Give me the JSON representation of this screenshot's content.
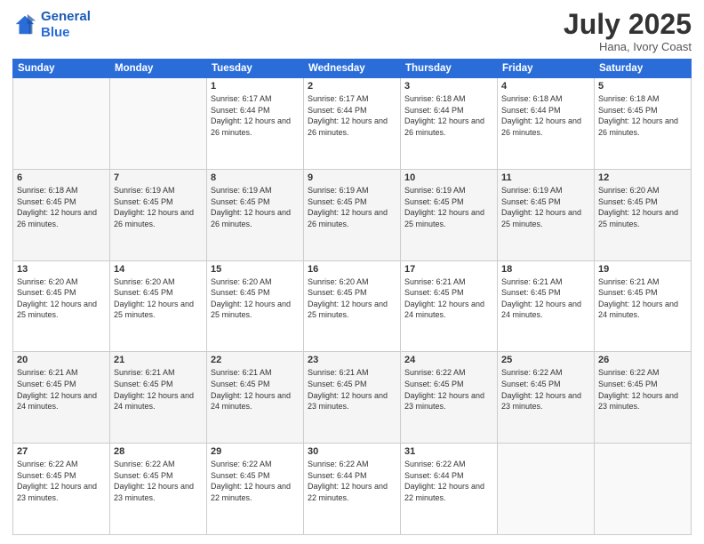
{
  "logo": {
    "line1": "General",
    "line2": "Blue"
  },
  "header": {
    "month": "July 2025",
    "location": "Hana, Ivory Coast"
  },
  "weekdays": [
    "Sunday",
    "Monday",
    "Tuesday",
    "Wednesday",
    "Thursday",
    "Friday",
    "Saturday"
  ],
  "weeks": [
    [
      {
        "day": "",
        "sunrise": "",
        "sunset": "",
        "daylight": ""
      },
      {
        "day": "",
        "sunrise": "",
        "sunset": "",
        "daylight": ""
      },
      {
        "day": "1",
        "sunrise": "Sunrise: 6:17 AM",
        "sunset": "Sunset: 6:44 PM",
        "daylight": "Daylight: 12 hours and 26 minutes."
      },
      {
        "day": "2",
        "sunrise": "Sunrise: 6:17 AM",
        "sunset": "Sunset: 6:44 PM",
        "daylight": "Daylight: 12 hours and 26 minutes."
      },
      {
        "day": "3",
        "sunrise": "Sunrise: 6:18 AM",
        "sunset": "Sunset: 6:44 PM",
        "daylight": "Daylight: 12 hours and 26 minutes."
      },
      {
        "day": "4",
        "sunrise": "Sunrise: 6:18 AM",
        "sunset": "Sunset: 6:44 PM",
        "daylight": "Daylight: 12 hours and 26 minutes."
      },
      {
        "day": "5",
        "sunrise": "Sunrise: 6:18 AM",
        "sunset": "Sunset: 6:45 PM",
        "daylight": "Daylight: 12 hours and 26 minutes."
      }
    ],
    [
      {
        "day": "6",
        "sunrise": "Sunrise: 6:18 AM",
        "sunset": "Sunset: 6:45 PM",
        "daylight": "Daylight: 12 hours and 26 minutes."
      },
      {
        "day": "7",
        "sunrise": "Sunrise: 6:19 AM",
        "sunset": "Sunset: 6:45 PM",
        "daylight": "Daylight: 12 hours and 26 minutes."
      },
      {
        "day": "8",
        "sunrise": "Sunrise: 6:19 AM",
        "sunset": "Sunset: 6:45 PM",
        "daylight": "Daylight: 12 hours and 26 minutes."
      },
      {
        "day": "9",
        "sunrise": "Sunrise: 6:19 AM",
        "sunset": "Sunset: 6:45 PM",
        "daylight": "Daylight: 12 hours and 26 minutes."
      },
      {
        "day": "10",
        "sunrise": "Sunrise: 6:19 AM",
        "sunset": "Sunset: 6:45 PM",
        "daylight": "Daylight: 12 hours and 25 minutes."
      },
      {
        "day": "11",
        "sunrise": "Sunrise: 6:19 AM",
        "sunset": "Sunset: 6:45 PM",
        "daylight": "Daylight: 12 hours and 25 minutes."
      },
      {
        "day": "12",
        "sunrise": "Sunrise: 6:20 AM",
        "sunset": "Sunset: 6:45 PM",
        "daylight": "Daylight: 12 hours and 25 minutes."
      }
    ],
    [
      {
        "day": "13",
        "sunrise": "Sunrise: 6:20 AM",
        "sunset": "Sunset: 6:45 PM",
        "daylight": "Daylight: 12 hours and 25 minutes."
      },
      {
        "day": "14",
        "sunrise": "Sunrise: 6:20 AM",
        "sunset": "Sunset: 6:45 PM",
        "daylight": "Daylight: 12 hours and 25 minutes."
      },
      {
        "day": "15",
        "sunrise": "Sunrise: 6:20 AM",
        "sunset": "Sunset: 6:45 PM",
        "daylight": "Daylight: 12 hours and 25 minutes."
      },
      {
        "day": "16",
        "sunrise": "Sunrise: 6:20 AM",
        "sunset": "Sunset: 6:45 PM",
        "daylight": "Daylight: 12 hours and 25 minutes."
      },
      {
        "day": "17",
        "sunrise": "Sunrise: 6:21 AM",
        "sunset": "Sunset: 6:45 PM",
        "daylight": "Daylight: 12 hours and 24 minutes."
      },
      {
        "day": "18",
        "sunrise": "Sunrise: 6:21 AM",
        "sunset": "Sunset: 6:45 PM",
        "daylight": "Daylight: 12 hours and 24 minutes."
      },
      {
        "day": "19",
        "sunrise": "Sunrise: 6:21 AM",
        "sunset": "Sunset: 6:45 PM",
        "daylight": "Daylight: 12 hours and 24 minutes."
      }
    ],
    [
      {
        "day": "20",
        "sunrise": "Sunrise: 6:21 AM",
        "sunset": "Sunset: 6:45 PM",
        "daylight": "Daylight: 12 hours and 24 minutes."
      },
      {
        "day": "21",
        "sunrise": "Sunrise: 6:21 AM",
        "sunset": "Sunset: 6:45 PM",
        "daylight": "Daylight: 12 hours and 24 minutes."
      },
      {
        "day": "22",
        "sunrise": "Sunrise: 6:21 AM",
        "sunset": "Sunset: 6:45 PM",
        "daylight": "Daylight: 12 hours and 24 minutes."
      },
      {
        "day": "23",
        "sunrise": "Sunrise: 6:21 AM",
        "sunset": "Sunset: 6:45 PM",
        "daylight": "Daylight: 12 hours and 23 minutes."
      },
      {
        "day": "24",
        "sunrise": "Sunrise: 6:22 AM",
        "sunset": "Sunset: 6:45 PM",
        "daylight": "Daylight: 12 hours and 23 minutes."
      },
      {
        "day": "25",
        "sunrise": "Sunrise: 6:22 AM",
        "sunset": "Sunset: 6:45 PM",
        "daylight": "Daylight: 12 hours and 23 minutes."
      },
      {
        "day": "26",
        "sunrise": "Sunrise: 6:22 AM",
        "sunset": "Sunset: 6:45 PM",
        "daylight": "Daylight: 12 hours and 23 minutes."
      }
    ],
    [
      {
        "day": "27",
        "sunrise": "Sunrise: 6:22 AM",
        "sunset": "Sunset: 6:45 PM",
        "daylight": "Daylight: 12 hours and 23 minutes."
      },
      {
        "day": "28",
        "sunrise": "Sunrise: 6:22 AM",
        "sunset": "Sunset: 6:45 PM",
        "daylight": "Daylight: 12 hours and 23 minutes."
      },
      {
        "day": "29",
        "sunrise": "Sunrise: 6:22 AM",
        "sunset": "Sunset: 6:45 PM",
        "daylight": "Daylight: 12 hours and 22 minutes."
      },
      {
        "day": "30",
        "sunrise": "Sunrise: 6:22 AM",
        "sunset": "Sunset: 6:44 PM",
        "daylight": "Daylight: 12 hours and 22 minutes."
      },
      {
        "day": "31",
        "sunrise": "Sunrise: 6:22 AM",
        "sunset": "Sunset: 6:44 PM",
        "daylight": "Daylight: 12 hours and 22 minutes."
      },
      {
        "day": "",
        "sunrise": "",
        "sunset": "",
        "daylight": ""
      },
      {
        "day": "",
        "sunrise": "",
        "sunset": "",
        "daylight": ""
      }
    ]
  ]
}
